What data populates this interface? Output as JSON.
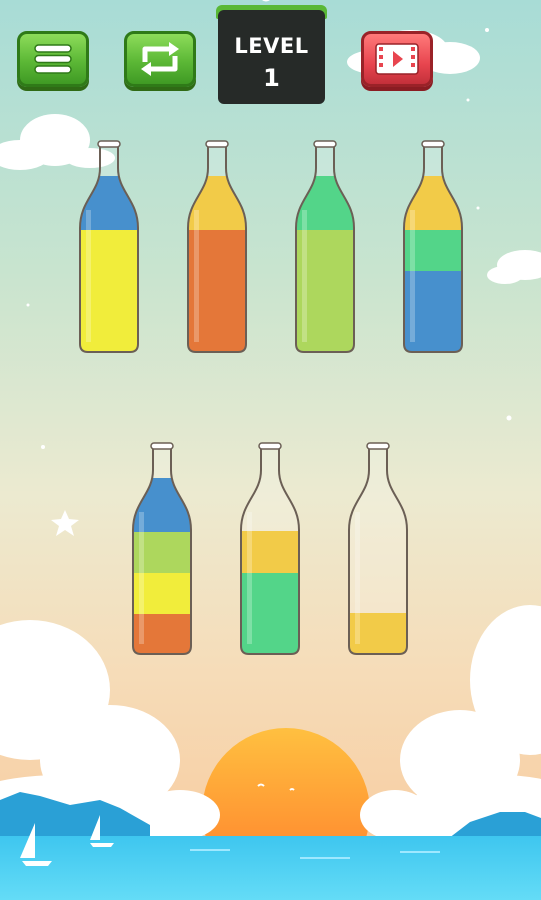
{
  "toolbar": {
    "menu_icon": "hamburger-menu-icon",
    "restart_icon": "repeat-arrows-icon",
    "video_icon": "video-play-icon"
  },
  "level": {
    "label": "LEVEL",
    "number": "1"
  },
  "bottles": [
    {
      "layers": [
        "#eeea10",
        "#eeea10",
        "#eeea10",
        "#1f78c2"
      ],
      "fill": 4
    },
    {
      "layers": [
        "#de5a0e",
        "#de5a0e",
        "#de5a0e",
        "#f0c020"
      ],
      "fill": 4
    },
    {
      "layers": [
        "#9ccf3a",
        "#9ccf3a",
        "#9ccf3a",
        "#2ecc6f"
      ],
      "fill": 4
    },
    {
      "layers": [
        "#1f78c2",
        "#1f78c2",
        "#2ecc6f",
        "#f0c020"
      ],
      "fill": 4
    },
    {
      "layers": [
        "#de5a0e",
        "#eeea10",
        "#9ccf3a",
        "#1f78c2"
      ],
      "fill": 4
    },
    {
      "layers": [
        "#2ecc6f",
        "#2ecc6f",
        "#f0c020"
      ],
      "fill": 3
    },
    {
      "layers": [
        "#f0c020"
      ],
      "fill": 1
    }
  ],
  "colors": {
    "yellow": "#eeea10",
    "orange": "#de5a0e",
    "lime": "#9ccf3a",
    "blue": "#1f78c2",
    "green": "#2ecc6f",
    "gold": "#f0c020"
  }
}
